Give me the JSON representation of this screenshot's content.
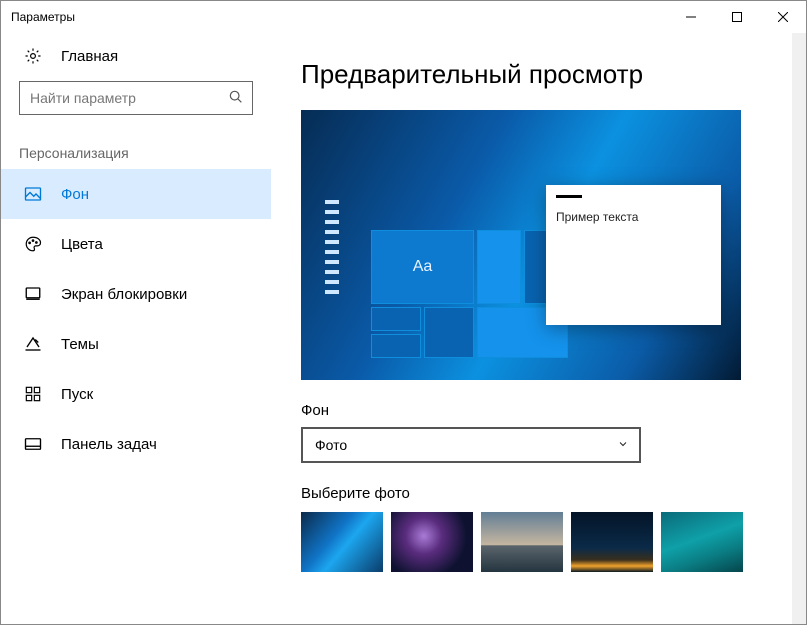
{
  "window": {
    "title": "Параметры"
  },
  "sidebar": {
    "home_label": "Главная",
    "search_placeholder": "Найти параметр",
    "category_label": "Персонализация",
    "items": [
      {
        "id": "background",
        "label": "Фон",
        "active": true
      },
      {
        "id": "colors",
        "label": "Цвета",
        "active": false
      },
      {
        "id": "lockscreen",
        "label": "Экран блокировки",
        "active": false
      },
      {
        "id": "themes",
        "label": "Темы",
        "active": false
      },
      {
        "id": "start",
        "label": "Пуск",
        "active": false
      },
      {
        "id": "taskbar",
        "label": "Панель задач",
        "active": false
      }
    ]
  },
  "main": {
    "preview_heading": "Предварительный просмотр",
    "preview_aa": "Aa",
    "preview_sample_text": "Пример текста",
    "background_section_label": "Фон",
    "background_select_value": "Фото",
    "choose_photo_label": "Выберите фото"
  }
}
